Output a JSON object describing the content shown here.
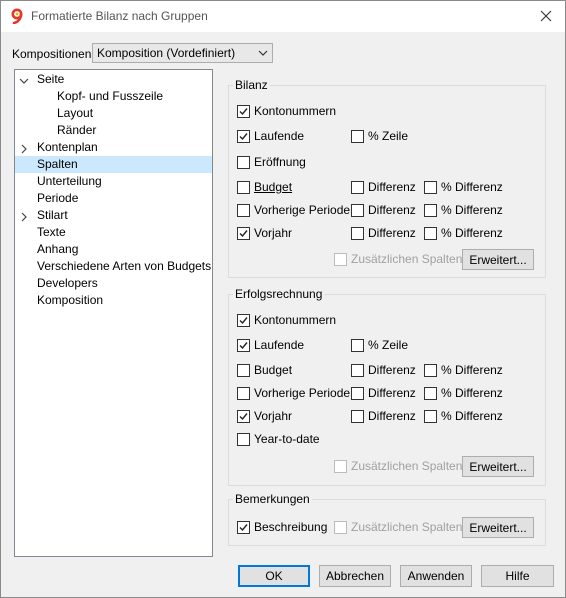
{
  "window": {
    "title": "Formatierte Bilanz nach Gruppen",
    "close_icon": "close-icon",
    "app_icon": "banana-app-icon"
  },
  "kompositionen": {
    "label": "Kompositionen:",
    "value": "Komposition (Vordefiniert)"
  },
  "tree": [
    {
      "label": "Seite",
      "expander": "collapse",
      "level": 0
    },
    {
      "label": "Kopf- und Fusszeile",
      "level": 1
    },
    {
      "label": "Layout",
      "level": 1
    },
    {
      "label": "Ränder",
      "level": 1
    },
    {
      "label": "Kontenplan",
      "expander": "expand",
      "level": 0
    },
    {
      "label": "Spalten",
      "level": 0,
      "selected": true
    },
    {
      "label": "Unterteilung",
      "level": 0
    },
    {
      "label": "Periode",
      "level": 0
    },
    {
      "label": "Stilart",
      "expander": "expand",
      "level": 0
    },
    {
      "label": "Texte",
      "level": 0
    },
    {
      "label": "Anhang",
      "level": 0
    },
    {
      "label": "Verschiedene Arten von Budgets",
      "level": 0
    },
    {
      "label": "Developers",
      "level": 0
    },
    {
      "label": "Komposition",
      "level": 0
    }
  ],
  "bilanz": {
    "title": "Bilanz",
    "kontonummern": {
      "label": "Kontonummern",
      "checked": true
    },
    "laufende": {
      "label": "Laufende",
      "checked": true
    },
    "laufende_zeile": {
      "label": "% Zeile",
      "checked": false
    },
    "eroeffnung": {
      "label": "Eröffnung",
      "checked": false
    },
    "budget": {
      "label": "Budget",
      "checked": false
    },
    "budget_diff": {
      "label": "Differenz",
      "checked": false
    },
    "budget_pdiff": {
      "label": "% Differenz",
      "checked": false
    },
    "vorherige": {
      "label": "Vorherige Periode",
      "checked": false
    },
    "vorherige_diff": {
      "label": "Differenz",
      "checked": false
    },
    "vorherige_pdiff": {
      "label": "% Differenz",
      "checked": false
    },
    "vorjahr": {
      "label": "Vorjahr",
      "checked": true
    },
    "vorjahr_diff": {
      "label": "Differenz",
      "checked": false
    },
    "vorjahr_pdiff": {
      "label": "% Differenz",
      "checked": false
    },
    "zusaetzlich": {
      "label": "Zusätzlichen Spalten",
      "checked": false
    },
    "erweitert": "Erweitert..."
  },
  "erfolgsrechnung": {
    "title": "Erfolgsrechnung",
    "kontonummern": {
      "label": "Kontonummern",
      "checked": true
    },
    "laufende": {
      "label": "Laufende",
      "checked": true
    },
    "laufende_zeile": {
      "label": "% Zeile",
      "checked": false
    },
    "budget": {
      "label": "Budget",
      "checked": false
    },
    "budget_diff": {
      "label": "Differenz",
      "checked": false
    },
    "budget_pdiff": {
      "label": "% Differenz",
      "checked": false
    },
    "vorherige": {
      "label": "Vorherige Periode",
      "checked": false
    },
    "vorherige_diff": {
      "label": "Differenz",
      "checked": false
    },
    "vorherige_pdiff": {
      "label": "% Differenz",
      "checked": false
    },
    "vorjahr": {
      "label": "Vorjahr",
      "checked": true
    },
    "vorjahr_diff": {
      "label": "Differenz",
      "checked": false
    },
    "vorjahr_pdiff": {
      "label": "% Differenz",
      "checked": false
    },
    "ytd": {
      "label": "Year-to-date",
      "checked": false
    },
    "zusaetzlich": {
      "label": "Zusätzlichen Spalten",
      "checked": false
    },
    "erweitert": "Erweitert..."
  },
  "bemerkungen": {
    "title": "Bemerkungen",
    "beschreibung": {
      "label": "Beschreibung",
      "checked": true
    },
    "zusaetzlich": {
      "label": "Zusätzlichen Spalten",
      "checked": false
    },
    "erweitert": "Erweitert..."
  },
  "footer": {
    "ok": "OK",
    "abbrechen": "Abbrechen",
    "anwenden": "Anwenden",
    "hilfe": "Hilfe"
  },
  "colors": {
    "selection": "#cce8ff",
    "default_button_border": "#0078d7",
    "app_icon_red": "#e03a2f"
  }
}
